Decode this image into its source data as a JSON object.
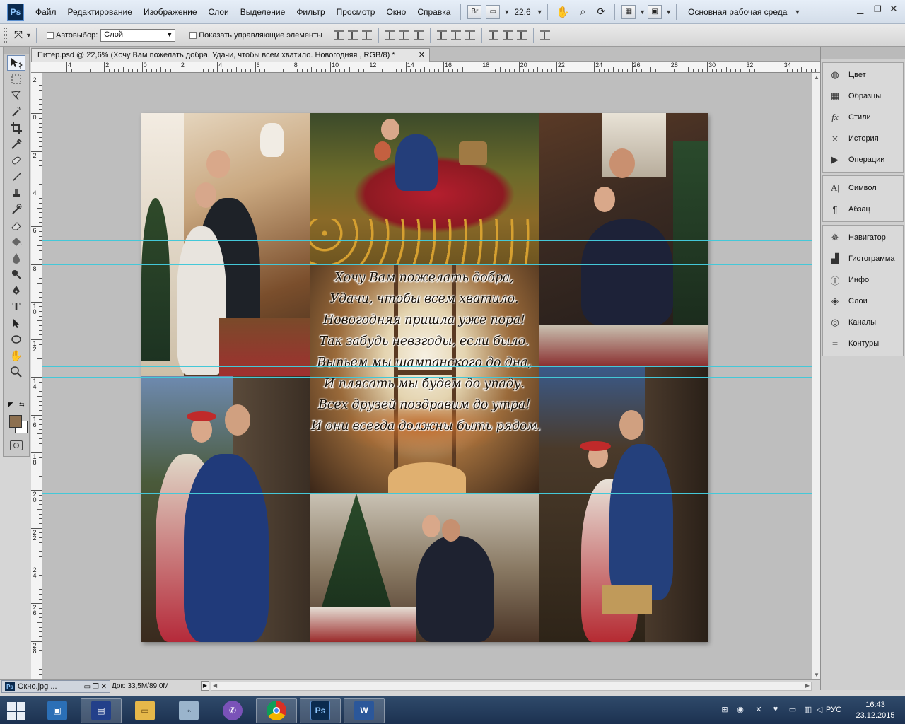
{
  "app": {
    "logo": "Ps",
    "menu": [
      "Файл",
      "Редактирование",
      "Изображение",
      "Слои",
      "Выделение",
      "Фильтр",
      "Просмотр",
      "Окно",
      "Справка"
    ],
    "bridge_label": "Br",
    "zoom_display": "22,6",
    "workspace": "Основная рабочая среда"
  },
  "options_bar": {
    "autoselect_label": "Автовыбор:",
    "autoselect_value": "Слой",
    "show_controls_label": "Показать управляющие элементы"
  },
  "document": {
    "tab_title": "Питер.psd @ 22,6% (Хочу Вам пожелать добра, Удачи, чтобы всем хватило. Новогодняя , RGB/8) *",
    "poem": [
      "Хочу Вам пожелать добра,",
      "Удачи, чтобы всем хватило.",
      "Новогодняя пришла уже пора!",
      "Так забудь невзгоды, если было.",
      "Выпьем мы шампанского до дна,",
      "И плясать мы будем до упаду.",
      "Всех друзей поздравим до утра!",
      "И они всегда должны быть рядом."
    ]
  },
  "rulers": {
    "top": [
      "4",
      "2",
      "0",
      "2",
      "4",
      "6",
      "8",
      "10",
      "12",
      "14",
      "16",
      "18",
      "20",
      "22",
      "24",
      "26",
      "28",
      "30",
      "32",
      "34"
    ],
    "left": [
      "2",
      "0",
      "2",
      "4",
      "6",
      "8",
      "10",
      "12",
      "14",
      "16",
      "18",
      "20",
      "22",
      "24",
      "26",
      "28"
    ]
  },
  "panels": {
    "group1": [
      {
        "label": "Цвет",
        "icon": "palette-icon"
      },
      {
        "label": "Образцы",
        "icon": "swatches-icon"
      },
      {
        "label": "Стили",
        "icon": "styles-icon"
      },
      {
        "label": "История",
        "icon": "history-icon"
      },
      {
        "label": "Операции",
        "icon": "actions-icon"
      }
    ],
    "group2": [
      {
        "label": "Символ",
        "icon": "character-icon"
      },
      {
        "label": "Абзац",
        "icon": "paragraph-icon"
      }
    ],
    "group3": [
      {
        "label": "Навигатор",
        "icon": "navigator-icon"
      },
      {
        "label": "Гистограмма",
        "icon": "histogram-icon"
      },
      {
        "label": "Инфо",
        "icon": "info-icon"
      },
      {
        "label": "Слои",
        "icon": "layers-icon"
      },
      {
        "label": "Каналы",
        "icon": "channels-icon"
      },
      {
        "label": "Контуры",
        "icon": "paths-icon"
      }
    ]
  },
  "status": {
    "minimized_doc": "Окно.jpg ...",
    "doc_info": "Док: 33,5M/89,0M"
  },
  "taskbar": {
    "language": "РУС",
    "time": "16:43",
    "date": "23.12.2015"
  },
  "colors": {
    "guide": "#44c8d8",
    "foreground": "#8d7050",
    "background": "#ffffff",
    "taskbar": "#1c3150"
  }
}
